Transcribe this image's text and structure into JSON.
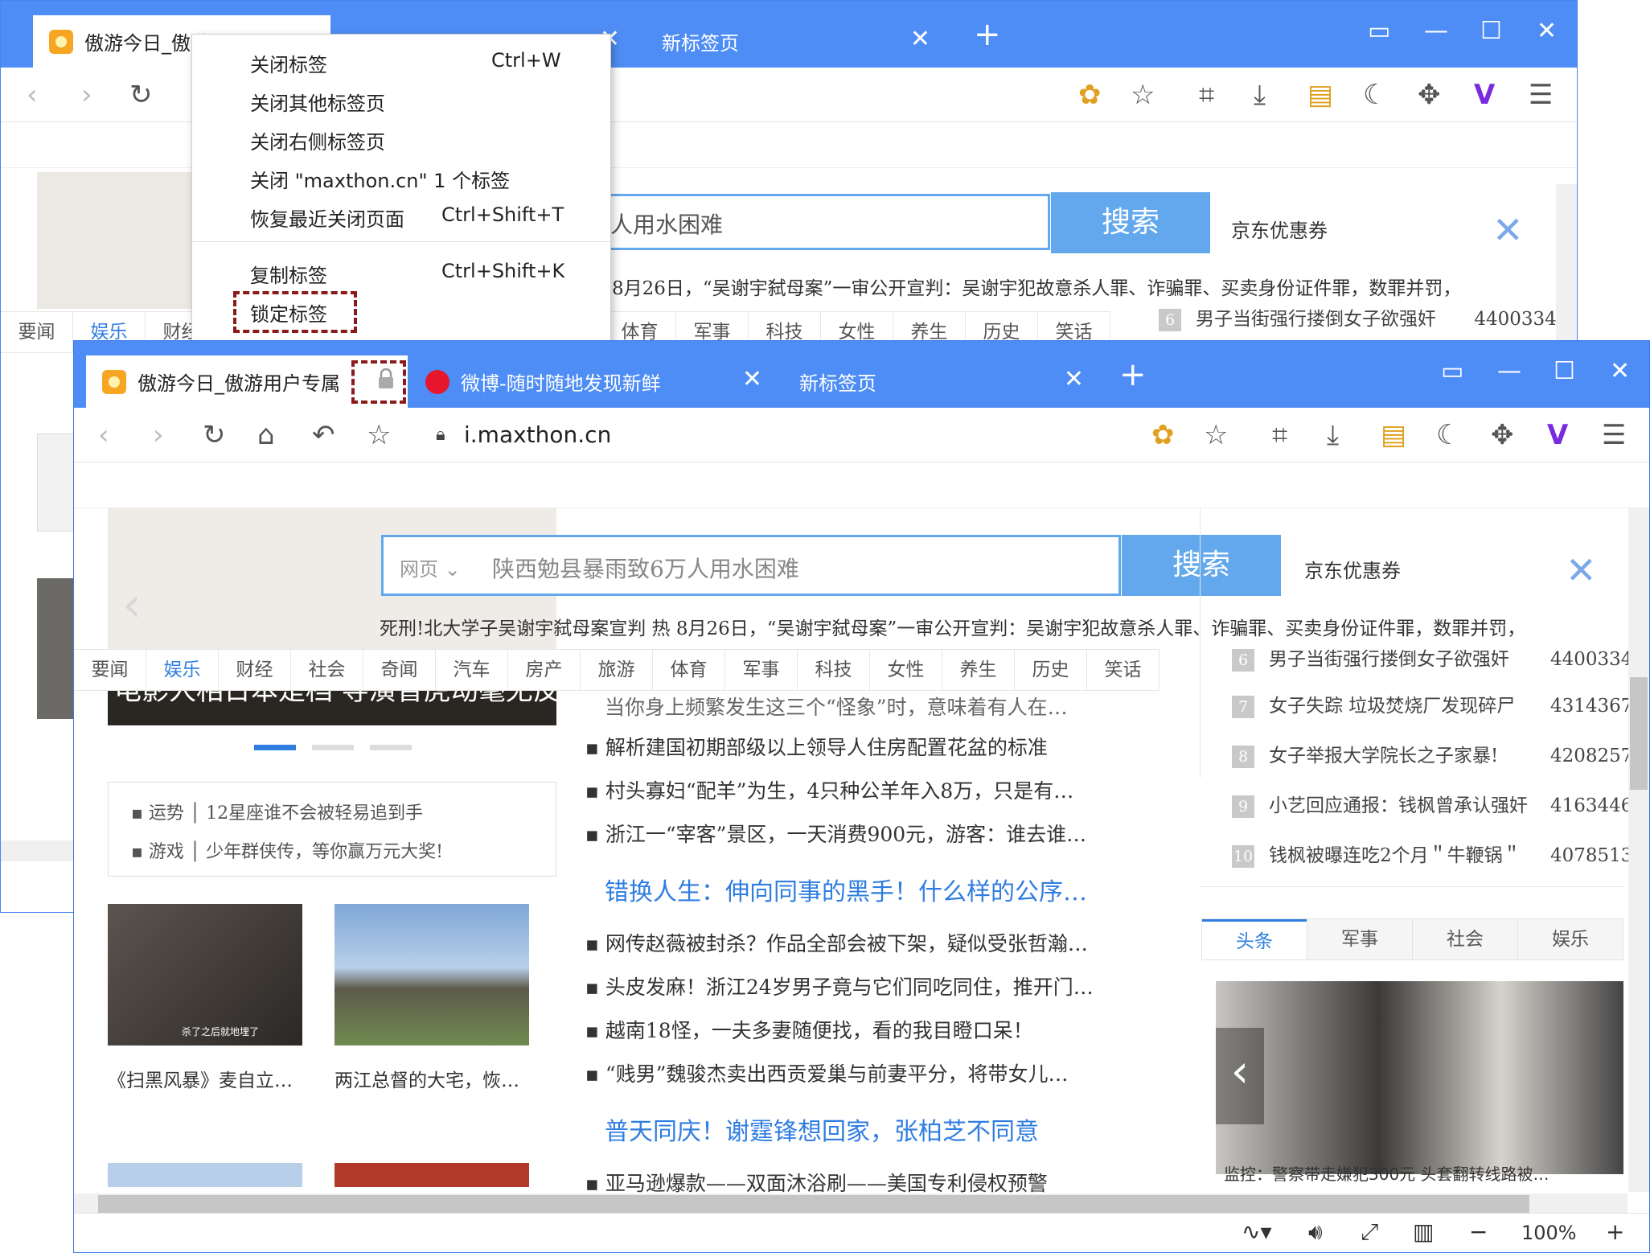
{
  "back_window": {
    "tabs": [
      {
        "label": "傲游今日_傲游"
      },
      {
        "label": "新标签页"
      }
    ],
    "search_placeholder": "人用水困难",
    "search_button": "搜索",
    "jd_coupon": "京东优惠券",
    "news_ticker": "8月26日，“吴谢宇弑母案”一审公开宣判：吴谢宇犯故意杀人罪、诈骗罪、买卖身份证件罪，数罪并罚，",
    "nav": [
      "要闻",
      "娱乐",
      "财经"
    ],
    "nav_right": [
      "体育",
      "军事",
      "科技",
      "女性",
      "养生",
      "历史",
      "笑话"
    ],
    "rank_6": "男子当街强行搂倒女子欲强奸",
    "rank_6_num": "4400334"
  },
  "context_menu": {
    "items": [
      {
        "label": "关闭标签",
        "shortcut": "Ctrl+W"
      },
      {
        "label": "关闭其他标签页",
        "shortcut": ""
      },
      {
        "label": "关闭右侧标签页",
        "shortcut": ""
      },
      {
        "label": "关闭 \"maxthon.cn\" 1 个标签",
        "shortcut": ""
      },
      {
        "label": "恢复最近关闭页面",
        "shortcut": "Ctrl+Shift+T"
      },
      {
        "label": "复制标签",
        "shortcut": "Ctrl+Shift+K"
      },
      {
        "label": "锁定标签",
        "shortcut": ""
      }
    ]
  },
  "front_window": {
    "tabs": [
      {
        "label": "傲游今日_傲游用户专属"
      },
      {
        "label": "微博-随时随地发现新鲜"
      },
      {
        "label": "新标签页"
      }
    ],
    "address": "i.maxthon.cn",
    "search": {
      "category": "网页",
      "placeholder": "陕西勉县暴雨致6万人用水困难",
      "button": "搜索"
    },
    "jd_coupon": "京东优惠券",
    "ticker": "死刑!北大学子吴谢宇弑母案宣判 热 8月26日，“吴谢宇弑母案”一审公开宣判：吴谢宇犯故意杀人罪、诈骗罪、买卖身份证件罪，数罪并罚，",
    "nav": [
      "要闻",
      "娱乐",
      "财经",
      "社会",
      "奇闻",
      "汽车",
      "房产",
      "旅游",
      "体育",
      "军事",
      "科技",
      "女性",
      "养生",
      "历史",
      "笑话"
    ],
    "nav_selected": "娱乐",
    "slider_caption": "电影人相日本是档 导演曾虎动毫无反应",
    "fortune": [
      {
        "tag": "运势",
        "text": "12星座谁不会被轻易追到手"
      },
      {
        "tag": "游戏",
        "text": "少年群侠传，等你赢万元大奖!"
      }
    ],
    "thumbs": [
      {
        "caption": "《扫黑风暴》麦自立…",
        "overlay": "杀了之后就地埋了"
      },
      {
        "caption": "两江总督的大宅，恢…",
        "overlay": ""
      }
    ],
    "news_top": "当你身上频繁发生这三个“怪象”时，意味着有人在…",
    "news_group1": [
      "解析建国初期部级以上领导人住房配置花盆的标准",
      "村头寡妇“配羊”为生，4只种公羊年入8万，只是有…",
      "浙江一“宰客”景区，一天消费900元，游客：谁去谁…"
    ],
    "headline1": "错换人生：伸向同事的黑手！什么样的公序…",
    "news_group2": [
      "网传赵薇被封杀？作品全部会被下架，疑似受张哲瀚…",
      "头皮发麻！浙江24岁男子竟与它们同吃同住，推开门…",
      "越南18怪，一夫多妻随便找，看的我目瞪口呆！",
      "“贱男”魏骏杰卖出西贡爱巢与前妻平分，将带女儿…"
    ],
    "headline2": "普天同庆！谢霆锋想回家，张柏芝不同意",
    "news_group3": [
      "亚马逊爆款——双面沐浴刷——美国专利侵权预警"
    ],
    "ranking": [
      {
        "n": "6",
        "title": "男子当街强行搂倒女子欲强奸",
        "count": "4400334"
      },
      {
        "n": "7",
        "title": "女子失踪 垃圾焚烧厂发现碎尸",
        "count": "4314367"
      },
      {
        "n": "8",
        "title": "女子举报大学院长之子家暴!",
        "count": "4208257"
      },
      {
        "n": "9",
        "title": "小艺回应通报：钱枫曾承认强奸",
        "count": "4163446"
      },
      {
        "n": "10",
        "title": "钱枫被曝连吃2个月＂牛鞭锅＂",
        "count": "4078513"
      }
    ],
    "side_tabs": [
      "头条",
      "军事",
      "社会",
      "娱乐"
    ],
    "side_caption": "监控：警察带走嫌犯300元 头套翻转线路被…",
    "zoom": "100%"
  },
  "colors": {
    "accent": "#4e8df5",
    "link": "#2f7de1",
    "search": "#63a8ec",
    "lock_box": "#8b1a1a"
  }
}
